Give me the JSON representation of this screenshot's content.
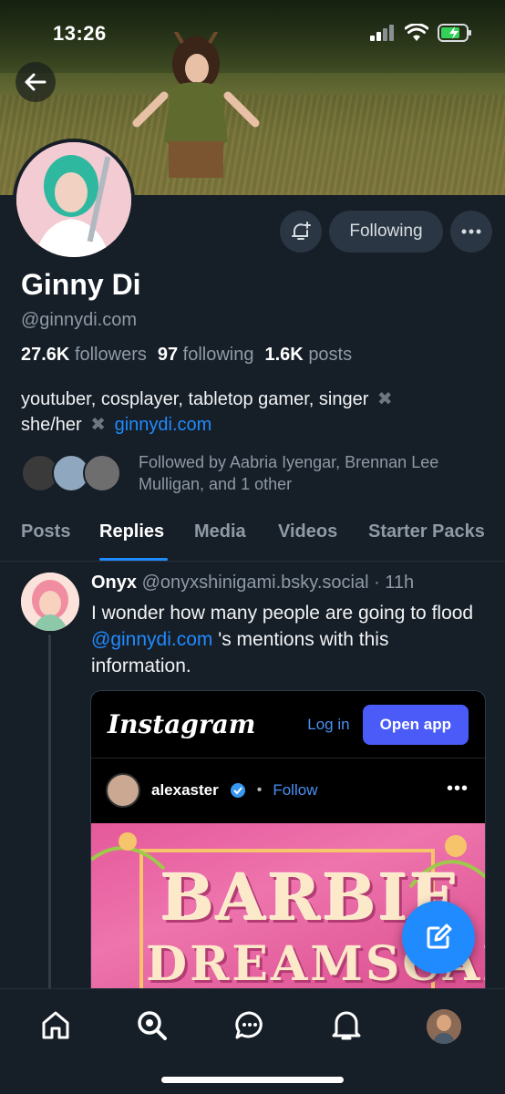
{
  "status_bar": {
    "time": "13:26"
  },
  "profile": {
    "display_name": "Ginny Di",
    "handle": "@ginnydi.com",
    "followers_count": "27.6K",
    "followers_label": "followers",
    "following_count": "97",
    "following_label": "following",
    "posts_count": "1.6K",
    "posts_label": "posts",
    "bio_line1": "youtuber, cosplayer, tabletop gamer, singer",
    "bio_pronouns": "she/her",
    "bio_link": "ginnydi.com",
    "followed_by": "Followed by Aabria Iyengar, Brennan Lee Mulligan, and 1 other"
  },
  "actions": {
    "following_label": "Following"
  },
  "tabs": [
    {
      "label": "Posts"
    },
    {
      "label": "Replies",
      "active": true
    },
    {
      "label": "Media"
    },
    {
      "label": "Videos"
    },
    {
      "label": "Starter Packs"
    }
  ],
  "post": {
    "author_name": "Onyx",
    "author_handle": "@onyxshinigami.bsky.social",
    "time": "· 11h",
    "text_before": "I wonder how many people are going to flood ",
    "mention": "@ginnydi.com",
    "text_after": " 's mentions with this information."
  },
  "embed": {
    "logo": "Instagram",
    "login_label": "Log in",
    "open_app_label": "Open app",
    "username": "alexaster",
    "dot": "•",
    "follow_label": "Follow",
    "more": "•••",
    "image_title": "BARBIE",
    "image_subtitle": "DREAMSCAPE"
  },
  "icons": {
    "back": "arrow-left-icon",
    "notify": "bell-plus-icon",
    "more": "ellipsis-icon",
    "compose": "compose-icon",
    "nav": [
      "home-icon",
      "search-icon",
      "chat-icon",
      "bell-icon",
      "profile-avatar"
    ]
  },
  "colors": {
    "accent": "#208bfe",
    "background": "#161e27",
    "muted": "#8e9aa6"
  }
}
